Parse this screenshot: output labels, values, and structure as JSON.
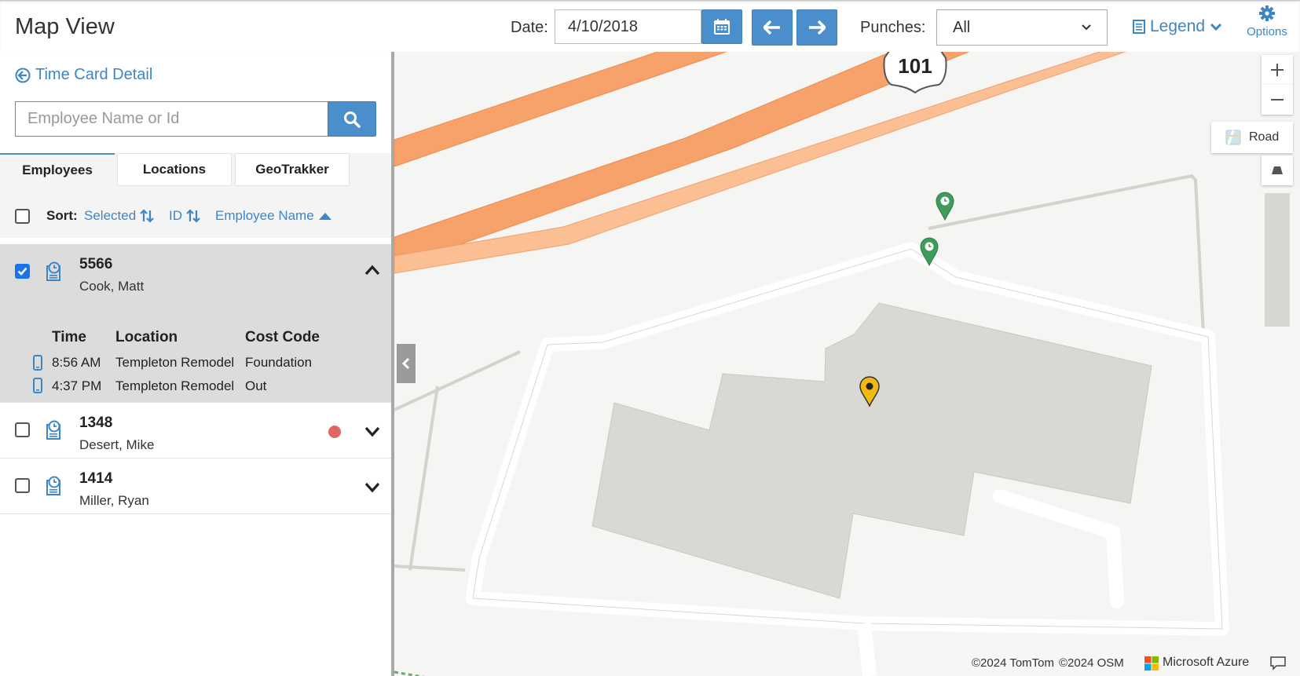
{
  "header": {
    "title": "Map View",
    "date_label": "Date:",
    "date_value": "4/10/2018",
    "punches_label": "Punches:",
    "punches_value": "All",
    "legend_label": "Legend",
    "options_label": "Options"
  },
  "sidebar": {
    "back_link": "Time Card Detail",
    "search_placeholder": "Employee Name or Id",
    "tabs": [
      {
        "label": "Employees",
        "active": true
      },
      {
        "label": "Locations",
        "active": false
      },
      {
        "label": "GeoTrakker",
        "active": false
      }
    ],
    "sort": {
      "label": "Sort:",
      "options": [
        "Selected",
        "ID",
        "Employee Name"
      ]
    },
    "employees": [
      {
        "id": "5566",
        "name": "Cook, Matt",
        "checked": true,
        "expanded": true,
        "detail_headers": [
          "Time",
          "Location",
          "Cost Code"
        ],
        "punches": [
          {
            "time": "8:56 AM",
            "location": "Templeton Remodel",
            "cost_code": "Foundation"
          },
          {
            "time": "4:37 PM",
            "location": "Templeton Remodel",
            "cost_code": "Out"
          }
        ]
      },
      {
        "id": "1348",
        "name": "Desert, Mike",
        "checked": false,
        "expanded": false,
        "status_dot": "#e06666"
      },
      {
        "id": "1414",
        "name": "Miller, Ryan",
        "checked": false,
        "expanded": false
      }
    ]
  },
  "map": {
    "highway_shield": "101",
    "map_type_label": "Road",
    "attribution": {
      "tomtom": "©2024 TomTom",
      "osm": "©2024 OSM",
      "azure": "Microsoft Azure"
    }
  },
  "colors": {
    "accent": "#4a8fcc",
    "highway": "#f7a26a",
    "building": "#d9d8d2",
    "pin_green": "#3f9d5c",
    "pin_yellow": "#f2b90f"
  }
}
